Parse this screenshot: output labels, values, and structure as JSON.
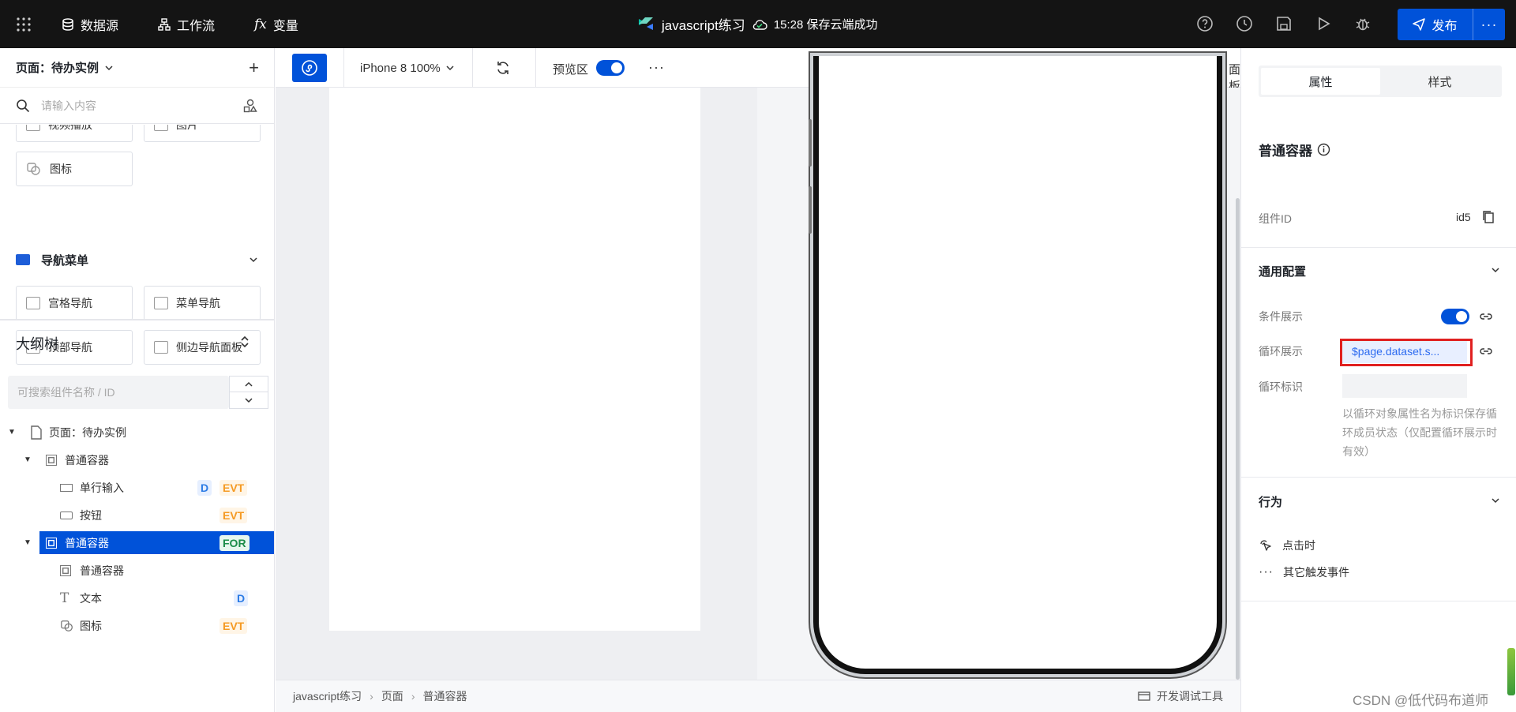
{
  "topbar": {
    "nav": [
      {
        "label": "数据源",
        "icon": "database-icon"
      },
      {
        "label": "工作流",
        "icon": "workflow-icon"
      },
      {
        "label": "变量",
        "icon": "fx-icon"
      }
    ],
    "app_name": "javascript练习",
    "save_status": "15:28 保存云端成功",
    "publish_label": "发布",
    "publish_more": "···"
  },
  "left": {
    "page_selector": "页面：待办实例",
    "search_placeholder": "请输入内容",
    "components_top": [
      "视频播放",
      "图片",
      "图标"
    ],
    "nav_group_title": "导航菜单",
    "nav_components": [
      "宫格导航",
      "菜单导航",
      "顶部导航",
      "侧边导航面板"
    ],
    "outline_title": "大纲树",
    "outline_search_placeholder": "可搜索组件名称 / ID",
    "tree": [
      {
        "label": "页面：待办实例",
        "tags": []
      },
      {
        "label": "普通容器",
        "tags": []
      },
      {
        "label": "单行输入",
        "tags": [
          "D",
          "EVT"
        ]
      },
      {
        "label": "按钮",
        "tags": [
          "EVT"
        ]
      },
      {
        "label": "普通容器",
        "tags": [
          "FOR"
        ],
        "selected": true
      },
      {
        "label": "普通容器",
        "tags": []
      },
      {
        "label": "文本",
        "tags": [
          "D"
        ]
      },
      {
        "label": "图标",
        "tags": [
          "EVT"
        ]
      }
    ]
  },
  "canvas": {
    "device": "iPhone 8 100%",
    "preview_label": "预览区",
    "more": "···",
    "panel_label": "面板",
    "breadcrumb": [
      "javascript练习",
      "页面",
      "普通容器"
    ],
    "devtools_label": "开发调试工具"
  },
  "right": {
    "tabs": [
      "属性",
      "样式"
    ],
    "component_title": "普通容器",
    "id_label": "组件ID",
    "id_value": "id5",
    "general_config": "通用配置",
    "cond_show_label": "条件展示",
    "loop_show_label": "循环展示",
    "loop_show_value": "$page.dataset.s...",
    "loop_key_label": "循环标识",
    "loop_key_hint": "以循环对象属性名为标识保存循环成员状态（仅配置循环展示时有效）",
    "behavior_title": "行为",
    "on_click": "点击时",
    "other_events": "其它触发事件"
  },
  "watermark": "CSDN @低代码布道师",
  "colors": {
    "accent": "#0052d9",
    "topbar": "#141414",
    "highlight": "#e02020"
  }
}
